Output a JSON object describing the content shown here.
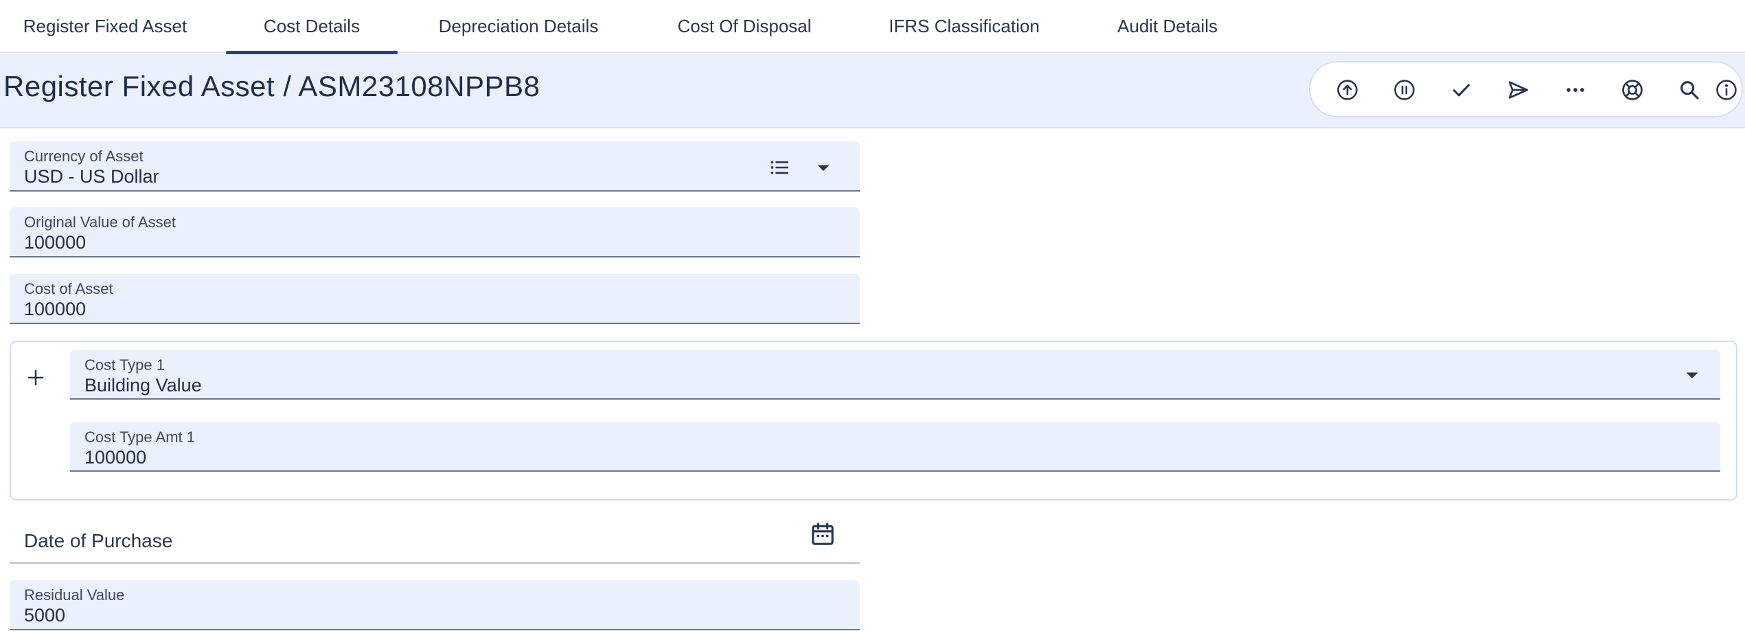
{
  "tabs": [
    {
      "label": "Register Fixed Asset",
      "active": false
    },
    {
      "label": "Cost Details",
      "active": true
    },
    {
      "label": "Depreciation Details",
      "active": false
    },
    {
      "label": "Cost Of Disposal",
      "active": false
    },
    {
      "label": "IFRS Classification",
      "active": false
    },
    {
      "label": "Audit Details",
      "active": false
    }
  ],
  "header": {
    "title": "Register Fixed Asset / ASM23108NPPB8"
  },
  "toolbar": {
    "icons": [
      "upload-icon",
      "pause-icon",
      "check-icon",
      "send-icon",
      "more-icon",
      "support-icon",
      "search-icon",
      "info-icon"
    ]
  },
  "form": {
    "currency": {
      "label": "Currency of Asset",
      "value": "USD - US Dollar"
    },
    "original_value": {
      "label": "Original Value of Asset",
      "value": "100000"
    },
    "cost": {
      "label": "Cost of Asset",
      "value": "100000"
    },
    "cost_type_1": {
      "label": "Cost Type 1",
      "value": "Building Value"
    },
    "cost_type_amt_1": {
      "label": "Cost Type Amt 1",
      "value": "100000"
    },
    "date_of_purchase": {
      "label": "Date of Purchase",
      "value": ""
    },
    "residual_value": {
      "label": "Residual Value",
      "value": "5000"
    }
  },
  "colors": {
    "field_bg": "#ebf1fc",
    "accent": "#2e3f78",
    "text": "#1f2d4d"
  }
}
